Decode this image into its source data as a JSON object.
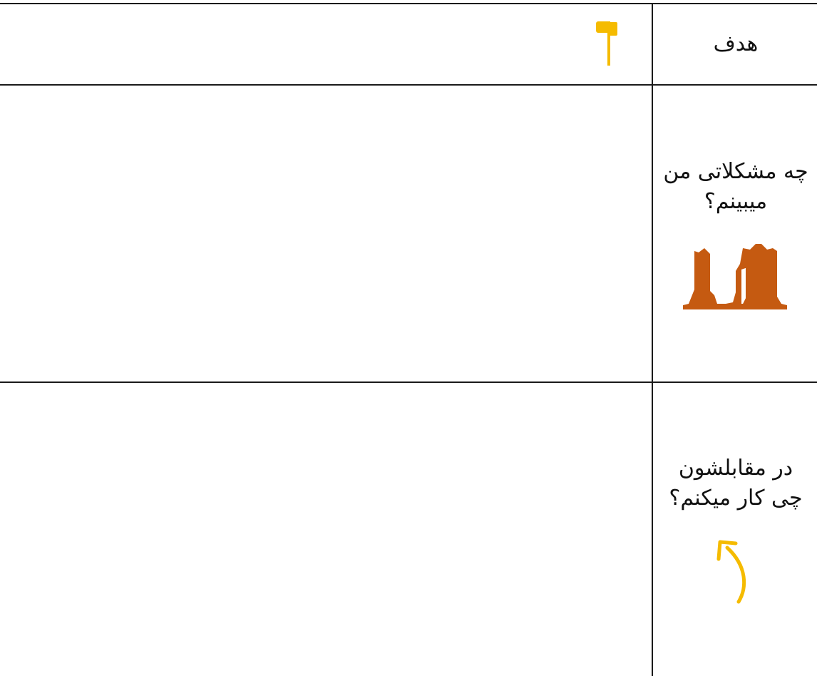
{
  "rows": [
    {
      "label": "هدف",
      "value": "",
      "icon": "flag-icon",
      "icon_color": "#F5BB00"
    },
    {
      "label": "چه مشکلاتی من\nمیبینم؟",
      "value": "",
      "icon": "rock-formation-icon",
      "icon_color": "#C55A11"
    },
    {
      "label": "در مقابلشون\nچی کار میکنم؟",
      "value": "",
      "icon": "curved-arrow-up-icon",
      "icon_color": "#F5BB00"
    }
  ]
}
